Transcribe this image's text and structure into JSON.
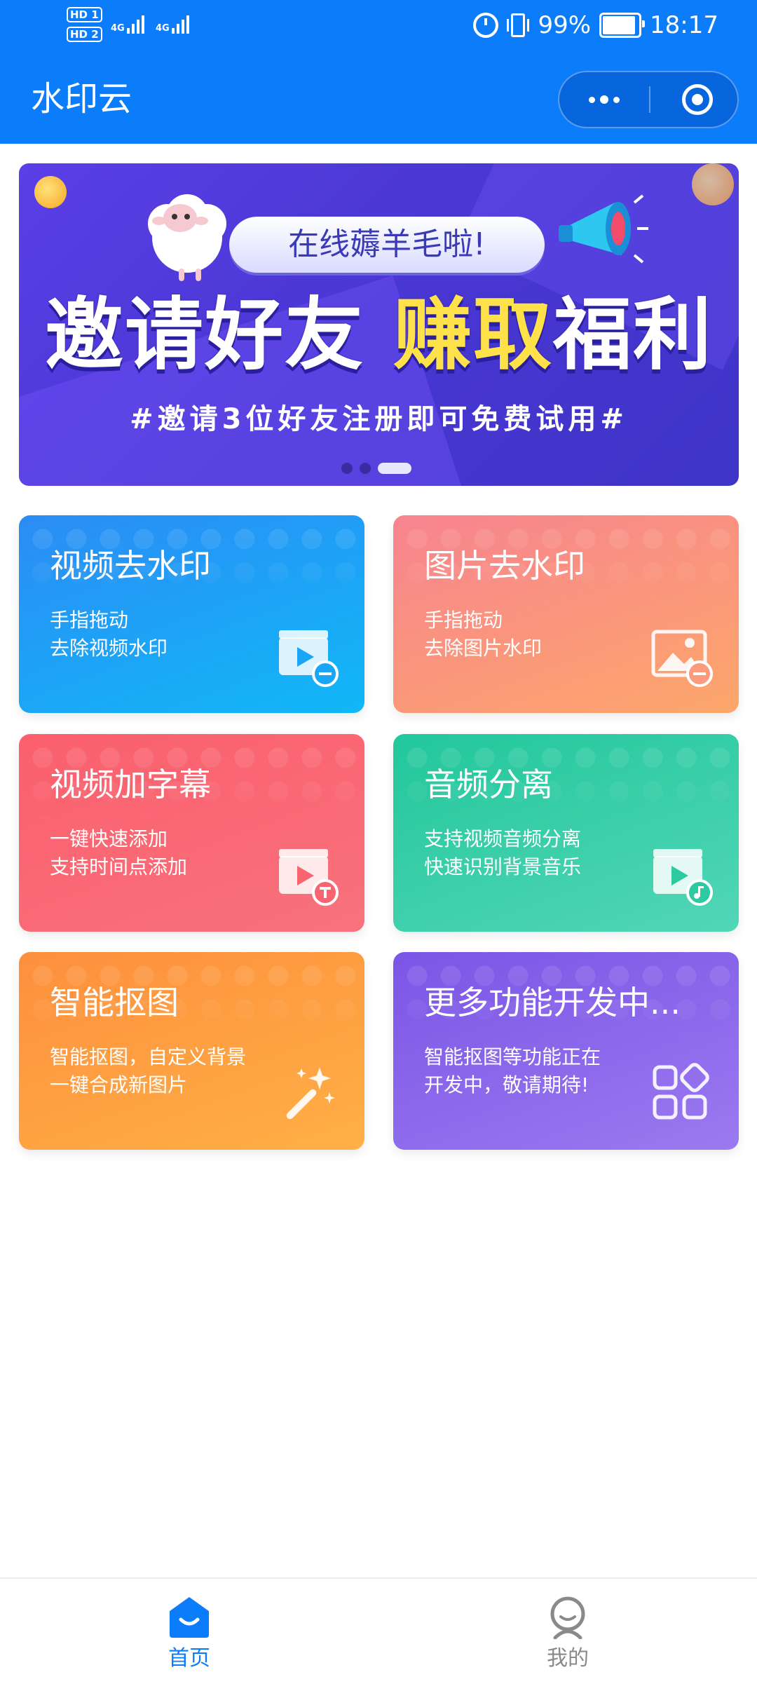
{
  "status_bar": {
    "sim1": "HD 1",
    "sim2": "HD 2",
    "network1": "4G",
    "network2": "4G",
    "battery": "99%",
    "time": "18:17",
    "battery_level": 0.99
  },
  "header": {
    "title": "水印云"
  },
  "banner": {
    "tagline": "在线薅羊毛啦!",
    "headline_white": "邀请好友 ",
    "headline_yellow": "赚取",
    "headline_white2": "福利",
    "subtitle": "#邀请3位好友注册即可免费试用#",
    "slides": 3,
    "active_slide": 3
  },
  "features": [
    {
      "title": "视频去水印",
      "line1": "手指拖动",
      "line2": "去除视频水印",
      "icon": "video-remove-icon"
    },
    {
      "title": "图片去水印",
      "line1": "手指拖动",
      "line2": "去除图片水印",
      "icon": "image-remove-icon"
    },
    {
      "title": "视频加字幕",
      "line1": "一键快速添加",
      "line2": "支持时间点添加",
      "icon": "video-subtitle-icon"
    },
    {
      "title": "音频分离",
      "line1": "支持视频音频分离",
      "line2": "快速识别背景音乐",
      "icon": "audio-separate-icon"
    },
    {
      "title": "智能抠图",
      "line1": "智能抠图，自定义背景",
      "line2": "一键合成新图片",
      "icon": "magic-wand-icon"
    },
    {
      "title": "更多功能开发中...",
      "line1": "智能抠图等功能正在",
      "line2": "开发中，敬请期待!",
      "icon": "apps-grid-icon"
    }
  ],
  "tabbar": {
    "home": "首页",
    "mine": "我的",
    "active": "home"
  },
  "colors": {
    "brand": "#0b7dfb",
    "tab_inactive": "#8a8a8a"
  }
}
